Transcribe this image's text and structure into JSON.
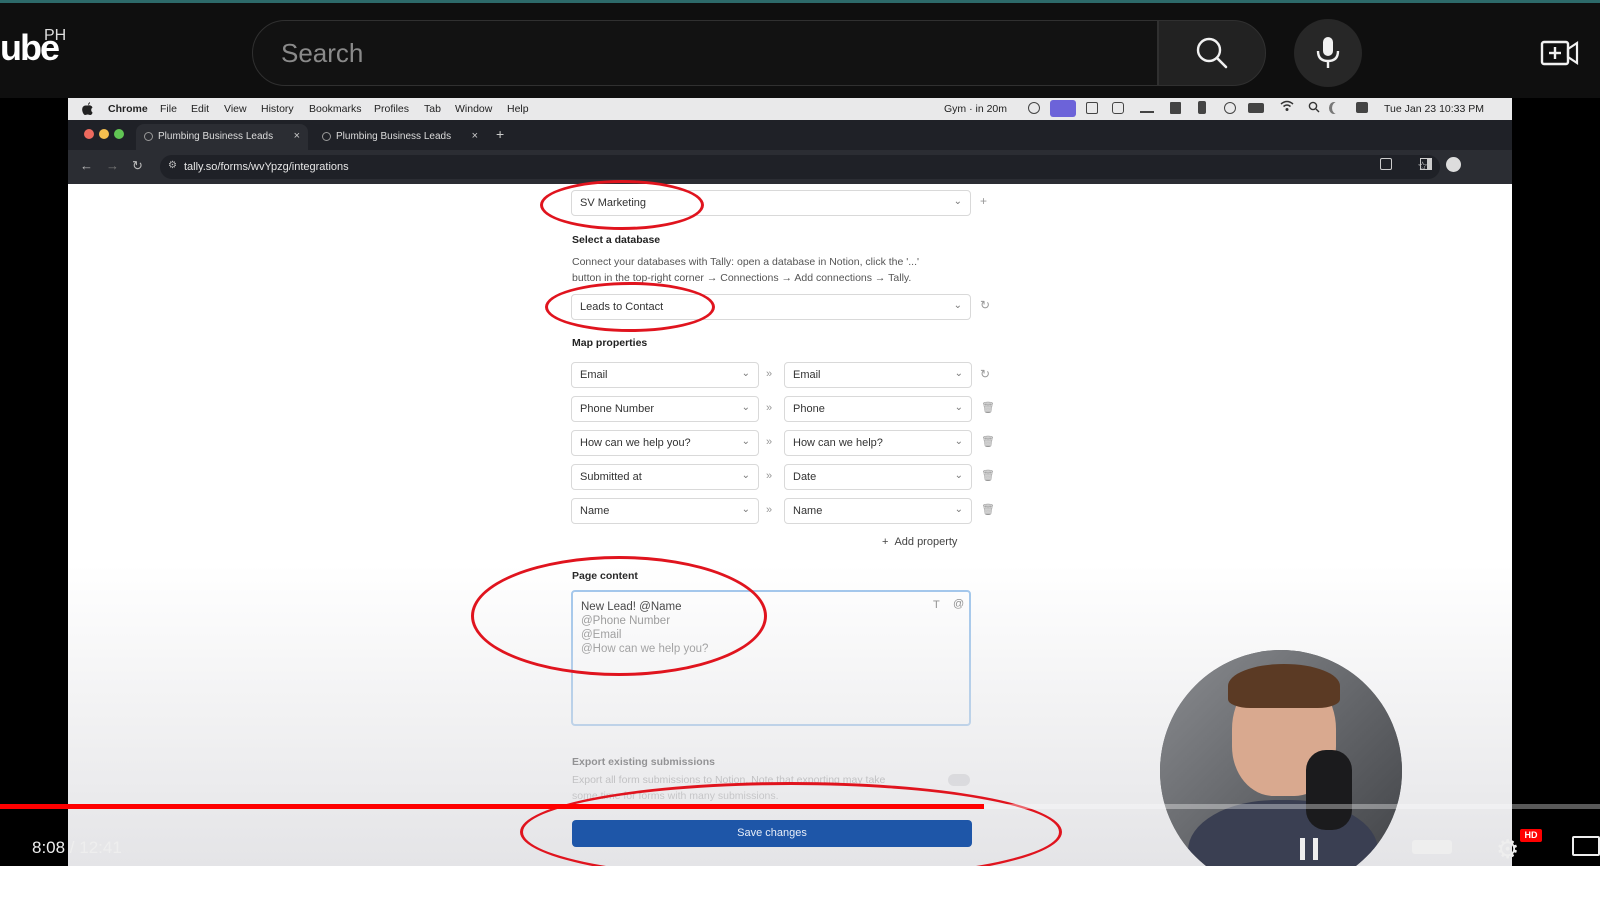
{
  "youtube": {
    "logo_text": "ube",
    "region": "PH",
    "search_placeholder": "Search"
  },
  "mac_menu": {
    "app": "Chrome",
    "items": [
      "File",
      "Edit",
      "View",
      "History",
      "Bookmarks",
      "Profiles",
      "Tab",
      "Window",
      "Help"
    ],
    "status_event": "Gym · in 20m",
    "clock": "Tue Jan 23  10:33 PM"
  },
  "chrome": {
    "tabs": [
      {
        "label": "Plumbing Business Leads",
        "close": "×"
      },
      {
        "label": "Plumbing Business Leads",
        "close": "×"
      }
    ],
    "new_tab": "+",
    "url": "tally.so/forms/wvYpzg/integrations"
  },
  "form": {
    "workspace_select": "SV Marketing",
    "select_database_heading": "Select a database",
    "database_help_line1": "Connect your databases with Tally: open a database in Notion, click the '...'",
    "database_help_line2": "button in the top-right corner → Connections → Add connections → Tally.",
    "database_select": "Leads to Contact",
    "map_properties_heading": "Map properties",
    "mappings": [
      {
        "from": "Email",
        "to": "Email"
      },
      {
        "from": "Phone Number",
        "to": "Phone"
      },
      {
        "from": "How can we help you?",
        "to": "How can we help?"
      },
      {
        "from": "Submitted at",
        "to": "Date"
      },
      {
        "from": "Name",
        "to": "Name"
      }
    ],
    "add_property": "Add property",
    "page_content_heading": "Page content",
    "page_content_lines": [
      "New Lead! @Name",
      "@Phone Number",
      "@Email",
      "@How can we help you?"
    ],
    "export_heading": "Export existing submissions",
    "export_help_line1": "Export all form submissions to Notion. Note that exporting may take",
    "export_help_line2": "some time for forms with many submissions.",
    "save_button": "Save changes"
  },
  "player": {
    "time": "8:08 / 12:41",
    "progress": 0.615,
    "hd_badge": "HD"
  },
  "colors": {
    "annotation_red": "#e0141e",
    "save_blue": "#1e56a8",
    "progress_red": "#ff0000"
  }
}
